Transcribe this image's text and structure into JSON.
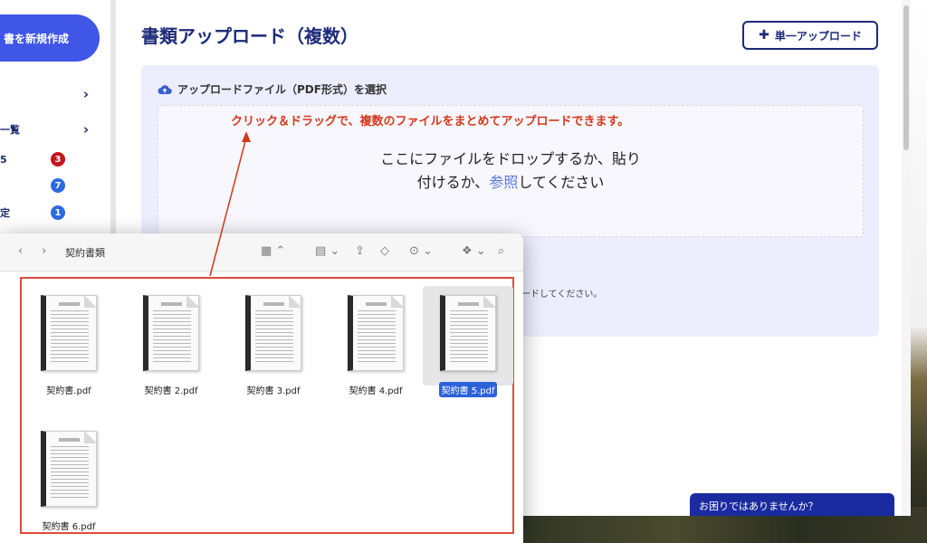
{
  "sidebar": {
    "new_doc_label": "書を新規作成",
    "rows": [
      {
        "label": "",
        "badge": ""
      },
      {
        "label": "一覧",
        "badge": ""
      },
      {
        "label": "5",
        "badge": "3"
      },
      {
        "label": "",
        "badge": "7"
      },
      {
        "label": "定",
        "badge": "1"
      }
    ]
  },
  "header": {
    "title": "書類アップロード（複数）",
    "single_upload_label": "単一アップロード"
  },
  "upload": {
    "panel_label": "アップロードファイル（PDF形式）を選択",
    "hint": "クリック＆ドラッグで、複数のファイルをまとめてアップロードできます。",
    "drop_line1": "ここにファイルをドロップするか、貼り",
    "drop_line2_prefix": "付けるか、",
    "drop_link": "参照",
    "drop_line2_suffix": "してください",
    "note": "ロードしてください。"
  },
  "help": {
    "label": "お困りではありませんか？"
  },
  "finder": {
    "folder_title": "契約書類",
    "files": [
      {
        "name": "契約書.pdf",
        "selected": false
      },
      {
        "name": "契約書 2.pdf",
        "selected": false
      },
      {
        "name": "契約書 3.pdf",
        "selected": false
      },
      {
        "name": "契約書 4.pdf",
        "selected": false
      },
      {
        "name": "契約書 5.pdf",
        "selected": true
      },
      {
        "name": "契約書 6.pdf",
        "selected": false
      }
    ]
  },
  "colors": {
    "accent": "#3f56e6",
    "title": "#1d2a7a",
    "hint": "#d3381c",
    "highlight_box": "#e14a3a",
    "panel_bg": "#eceefe"
  }
}
